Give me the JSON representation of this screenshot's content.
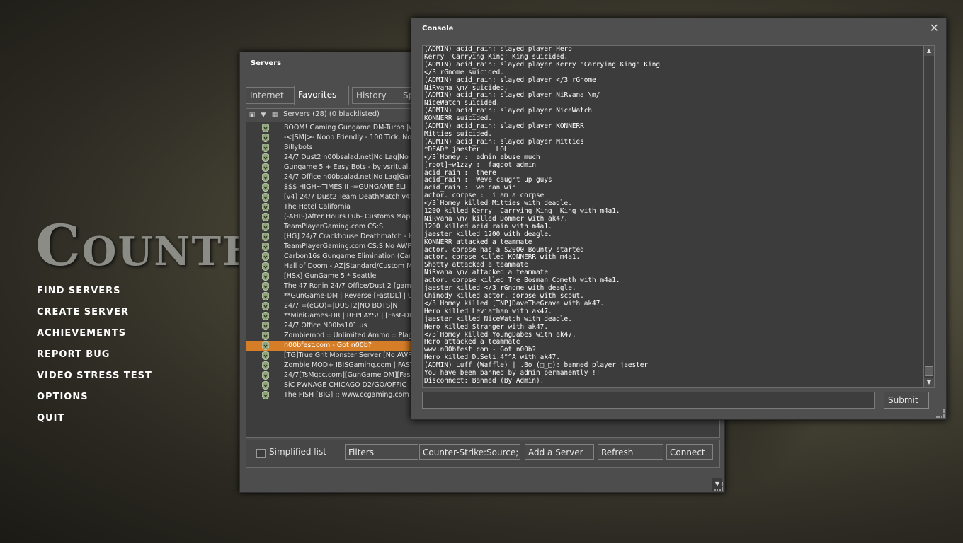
{
  "logo_text": "Counte",
  "main_menu": [
    "FIND SERVERS",
    "CREATE SERVER",
    "ACHIEVEMENTS",
    "REPORT BUG",
    "VIDEO STRESS TEST",
    "OPTIONS",
    "QUIT"
  ],
  "servers": {
    "title": "Servers",
    "tabs": [
      "Internet",
      "Favorites",
      "History",
      "Sp"
    ],
    "active_tab": "Favorites",
    "list_header": "Servers (28) (0 blacklisted)",
    "rows": [
      "BOOM! Gaming Gungame DM-Turbo |w",
      "-<|SM|>- Noob Friendly - 100 Tick, No",
      "Billybots",
      " 24/7 Dust2 n00bsalad.net|No Lag|No Bo",
      "Gungame 5 + Easy Bots - by vsritual.co",
      " 24/7 Office n00bsalad.net|No Lag|Game",
      "  $$$ HIGH~TIMES II -=GUNGAME ELI",
      "[v4] 24/7 Dust2 Team DeathMatch v4Ser",
      "The Hotel California",
      "(-AHP-)After Hours Pub- Customs Maps",
      "TeamPlayerGaming.com CS:S",
      "[HG] 24/7 Crackhouse Deathmatch - He",
      "TeamPlayerGaming.com CS:S No AWP/",
      "Carbon16s Gungame Elimination (Carbo",
      "Hall of Doom - AZ|Standard/Custom Ma",
      "[HSx] GunGame 5 * Seattle",
      "The 47 Ronin 24/7 Office/Dust 2 [gameM",
      "**GunGame-DM | Reverse [FastDL] | U",
      "      24/7 =(eGO)=|DUST2|NO BOTS|N",
      "**MiniGames-DR | REPLAYS! | [Fast-DL",
      "24/7 Office N00bs101.us",
      "Zombiemod :: Unlimited Ammo :: Plagu",
      "n00bfest.com - Got n00b?",
      "[TG]True Grit Monster Server [No AWP",
      "Zombie MOD+ IBISGaming.com | FAST",
      "24/7[TsMgcc.com][GunGame DM][Fast",
      "SiC PWNAGE CHICAGO D2/GO/OFFIC",
      "The FISH [BIG] :: www.ccgaming.com"
    ],
    "selected_row": 22,
    "simplified_list_label": "Simplified list",
    "filters_label": "Filters",
    "game_filter": "Counter-Strike:Source;",
    "add_server_label": "Add a Server",
    "refresh_label": "Refresh",
    "connect_label": "Connect"
  },
  "console": {
    "title": "Console",
    "lines": [
      "(ADMIN) acid_rain: slayed player Hero",
      "Kerry 'Carrying King' King suicided.",
      "(ADMIN) acid_rain: slayed player Kerry 'Carrying King' King",
      "</3 rGnome suicided.",
      "(ADMIN) acid_rain: slayed player </3 rGnome",
      "NiRvana \\m/ suicided.",
      "(ADMIN) acid_rain: slayed player NiRvana \\m/",
      "NiceWatch suicided.",
      "(ADMIN) acid_rain: slayed player NiceWatch",
      "KONNERR suicided.",
      "(ADMIN) acid_rain: slayed player KONNERR",
      "Mitties suicided.",
      "(ADMIN) acid_rain: slayed player Mitties",
      "*DEAD* jaester :  LOL",
      "</3`Homey :  admin abuse much",
      "[root]+w1zzy :  faggot admin",
      "acid_rain :  there",
      "acid_rain :  Weve caught up guys",
      "acid_rain :  we can win",
      "actor. corpse :  i am a corpse",
      "</3`Homey killed Mitties with deagle.",
      "1200 killed Kerry 'Carrying King' King with m4a1.",
      "NiRvana \\m/ killed Dommer with ak47.",
      "1200 killed acid_rain with m4a1.",
      "jaester killed 1200 with deagle.",
      "KONNERR attacked a teammate",
      "actor. corpse has a $2000 Bounty started",
      "actor. corpse killed KONNERR with m4a1.",
      "Shotty attacked a teammate",
      "NiRvana \\m/ attacked a teammate",
      "actor. corpse killed The Bosman Cometh with m4a1.",
      "jaester killed </3 rGnome with deagle.",
      "Chinody killed actor. corpse with scout.",
      "</3`Homey killed [TNP]DaveTheGrave with ak47.",
      "Hero killed Leviathan with ak47.",
      "jaester killed NiceWatch with deagle.",
      "Hero killed Stranger with ak47.",
      "</3`Homey killed YoungDabes with ak47.",
      "Hero attacked a teammate",
      "www.n00bfest.com - Got n00b?",
      "Hero killed D.Seli.4°^A with ak47.",
      "(ADMIN) Luff (Waffle) | .Bo (□_□): banned player jaester",
      "You have been banned by admin permanently !!",
      "Disconnect: Banned (By Admin)."
    ],
    "input_value": "",
    "submit_label": "Submit"
  }
}
